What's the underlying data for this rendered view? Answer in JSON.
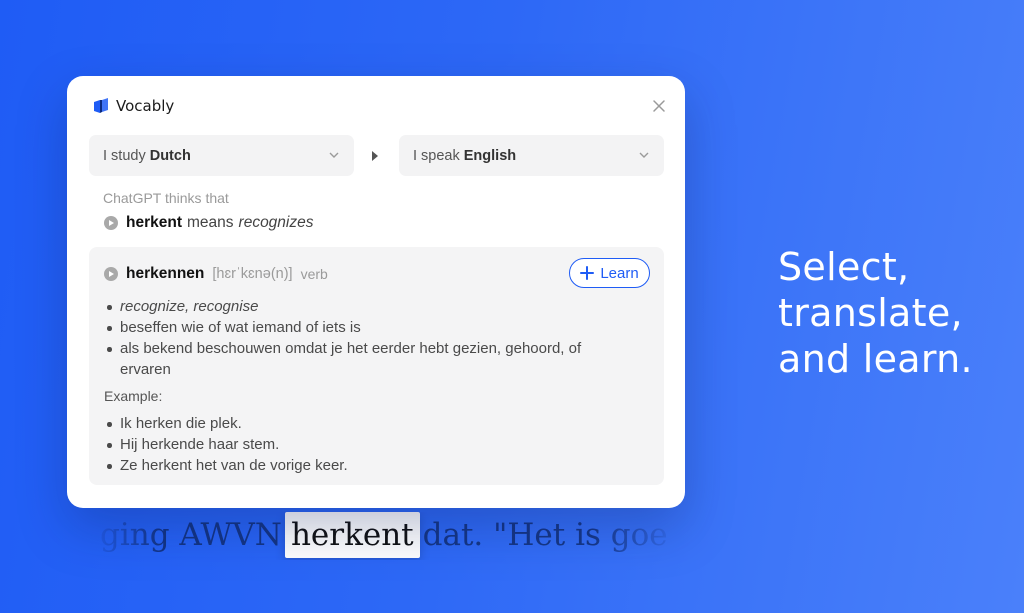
{
  "tagline": {
    "line1": "Select,",
    "line2": "translate,",
    "line3": "and learn."
  },
  "background_sentence": {
    "before": "ging AWVN",
    "highlight": "herkent",
    "after": "dat. \"Het is goe"
  },
  "popup": {
    "brand": "Vocably",
    "study_select": {
      "prefix": "I study",
      "value": "Dutch"
    },
    "speak_select": {
      "prefix": "I speak",
      "value": "English"
    },
    "gpt_label": "ChatGPT thinks that",
    "gpt_line": {
      "word": "herkent",
      "verb": "means",
      "translation": "recognizes"
    },
    "entry": {
      "lemma": "herkennen",
      "ipa": "[hɛrˈkɛnə(n)]",
      "pos": "verb",
      "learn_label": "Learn",
      "definitions": [
        "recognize, recognise",
        "beseffen wie of wat iemand of iets is",
        "als bekend beschouwen omdat je het eerder hebt gezien, gehoord, of ervaren"
      ],
      "example_label": "Example:",
      "examples": [
        "Ik herken die plek.",
        "Hij herkende haar stem.",
        "Ze herkent het van de vorige keer."
      ]
    }
  },
  "colors": {
    "accent": "#1f5cf5",
    "background": "#2d68f6",
    "card": "#ffffff",
    "panel": "#f4f4f5"
  },
  "icons": [
    "vocably-logo-icon",
    "close-icon",
    "chevron-down-icon",
    "arrow-right-icon",
    "play-icon",
    "plus-icon"
  ]
}
